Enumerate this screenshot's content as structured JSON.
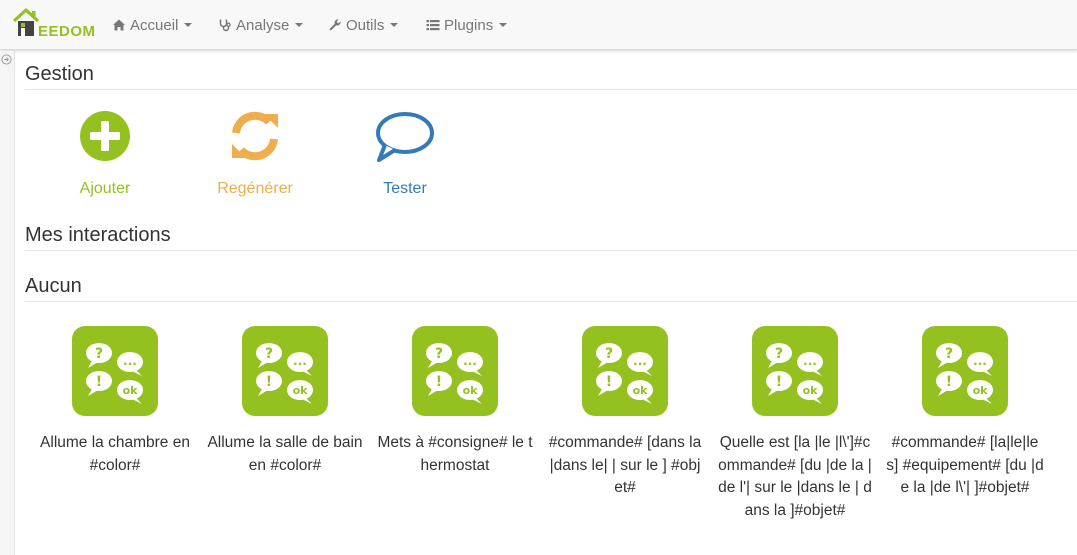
{
  "brand": {
    "logo_text": "EEDOM",
    "logo_icon": "jeedom-house-logo"
  },
  "nav": {
    "items": [
      {
        "label": "Accueil",
        "icon": "home-icon"
      },
      {
        "label": "Analyse",
        "icon": "stethoscope-icon"
      },
      {
        "label": "Outils",
        "icon": "wrench-icon"
      },
      {
        "label": "Plugins",
        "icon": "list-icon"
      }
    ]
  },
  "gestion": {
    "title": "Gestion",
    "actions": [
      {
        "label": "Ajouter",
        "icon": "plus-circle-icon",
        "color": "#94c11f"
      },
      {
        "label": "Regénérer",
        "icon": "refresh-icon",
        "color": "#f0ad4e"
      },
      {
        "label": "Tester",
        "icon": "speech-bubble-icon",
        "color": "#337ab7"
      }
    ]
  },
  "interactions": {
    "title": "Mes interactions",
    "group_title": "Aucun",
    "items": [
      {
        "name": "Allume la chambre en #color#"
      },
      {
        "name": "Allume la salle de bain en #color#"
      },
      {
        "name": "Mets à #consigne# le thermostat"
      },
      {
        "name": "#commande# [dans la |dans le| | sur le ] #objet#"
      },
      {
        "name": "Quelle est [la |le |l\\']#commande# [du |de la |de l'| sur le |dans le | dans la ]#objet#"
      },
      {
        "name": "#commande# [la|le|les] #equipement# [du |de la |de l\\'| ]#objet#"
      }
    ]
  },
  "colors": {
    "accent_green": "#94c11f",
    "orange": "#f0ad4e",
    "blue": "#337ab7"
  }
}
